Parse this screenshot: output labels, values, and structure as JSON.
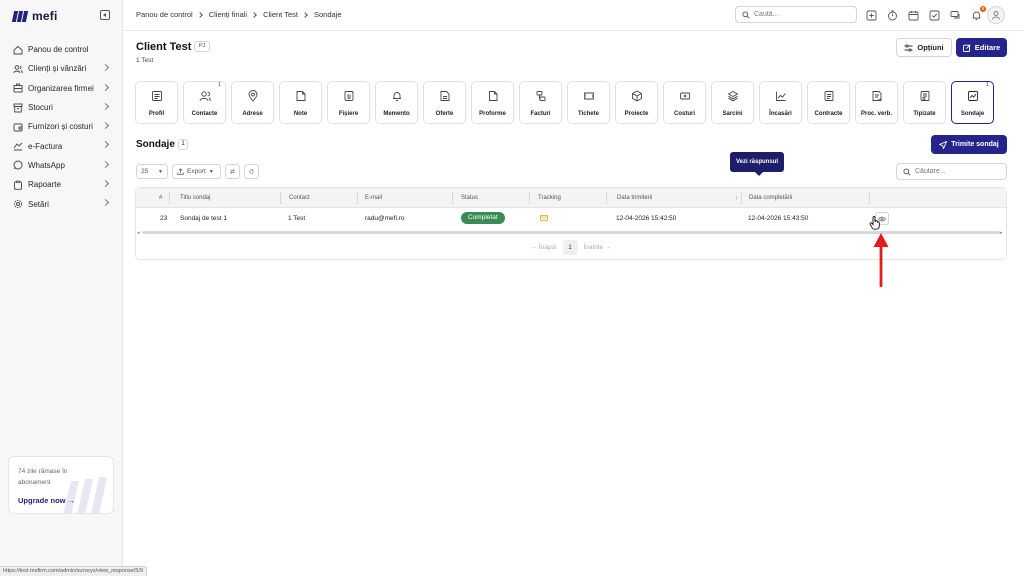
{
  "app": {
    "name": "mefi"
  },
  "sidebar": {
    "items": [
      {
        "label": "Panou de control",
        "icon": "home-icon",
        "chevron": false
      },
      {
        "label": "Clienți și vânzări",
        "icon": "users-icon",
        "chevron": true
      },
      {
        "label": "Organizarea firmei",
        "icon": "org-icon",
        "chevron": true
      },
      {
        "label": "Stocuri",
        "icon": "box-icon",
        "chevron": true
      },
      {
        "label": "Furnizori și costuri",
        "icon": "wallet-icon",
        "chevron": true
      },
      {
        "label": "e-Factura",
        "icon": "efactura-icon",
        "chevron": true
      },
      {
        "label": "WhatsApp",
        "icon": "whatsapp-icon",
        "chevron": true
      },
      {
        "label": "Rapoarte",
        "icon": "clipboard-icon",
        "chevron": true
      },
      {
        "label": "Setări",
        "icon": "gear-icon",
        "chevron": true
      }
    ],
    "upgrade": {
      "days_text": "74 zile rămase în abonament",
      "link_label": "Upgrade now"
    }
  },
  "header": {
    "breadcrumbs": [
      "Panou de control",
      "Clienți finali",
      "Client Test",
      "Sondaje"
    ],
    "search_placeholder": "Caută...",
    "notification_count": "9"
  },
  "client": {
    "name": "Client Test",
    "type_badge": "PJ",
    "contact_line": "1 Test",
    "options_label": "Opțiuni",
    "edit_label": "Editare"
  },
  "tabs": [
    {
      "label": "Profil",
      "icon": "profile-icon",
      "count": ""
    },
    {
      "label": "Contacte",
      "icon": "contacts-icon",
      "count": "1"
    },
    {
      "label": "Adrese",
      "icon": "pin-icon",
      "count": ""
    },
    {
      "label": "Note",
      "icon": "note-icon",
      "count": ""
    },
    {
      "label": "Fișiere",
      "icon": "file-icon",
      "count": ""
    },
    {
      "label": "Memento",
      "icon": "bell-icon",
      "count": ""
    },
    {
      "label": "Oferte",
      "icon": "offer-icon",
      "count": ""
    },
    {
      "label": "Proforme",
      "icon": "proforma-icon",
      "count": ""
    },
    {
      "label": "Facturi",
      "icon": "invoice-icon",
      "count": ""
    },
    {
      "label": "Tichete",
      "icon": "ticket-icon",
      "count": ""
    },
    {
      "label": "Proiecte",
      "icon": "cube-icon",
      "count": ""
    },
    {
      "label": "Costuri",
      "icon": "cost-icon",
      "count": ""
    },
    {
      "label": "Sarcini",
      "icon": "layers-icon",
      "count": ""
    },
    {
      "label": "Încasări",
      "icon": "chart-line-icon",
      "count": ""
    },
    {
      "label": "Contracte",
      "icon": "contract-icon",
      "count": ""
    },
    {
      "label": "Proc. verb.",
      "icon": "report-icon",
      "count": ""
    },
    {
      "label": "Tipizate",
      "icon": "form-icon",
      "count": ""
    },
    {
      "label": "Sondaje",
      "icon": "survey-icon",
      "count": "1"
    }
  ],
  "surveys": {
    "title": "Sondaje",
    "count": "1",
    "send_label": "Trimite sondaj",
    "page_size": "25",
    "export_label": "Export",
    "search_placeholder": "Căutare...",
    "columns": [
      "#",
      "Titlu sondaj",
      "Contact",
      "E-mail",
      "Status",
      "Tracking",
      "Data trimiterii",
      "Data completării"
    ],
    "rows": [
      {
        "id": "23",
        "title": "Sondaj de test 1",
        "contact": "1 Test",
        "email": "radu@mefi.ro",
        "status": "Completat",
        "sent": "12-04-2026 15:42:50",
        "completed": "12-04-2026 15:43:50"
      }
    ],
    "tooltip": "Vezi răspunsul",
    "pager": {
      "prev": "Înapoi",
      "page": "1",
      "next": "Înainte"
    }
  },
  "colors": {
    "accent": "#24248a",
    "status_completed": "#3a8a55",
    "tracking_mail": "#e8b339",
    "annotation_arrow": "#e11d1d"
  },
  "statusbar_url": "https://test.mefirm.com/admin/surveys/view_response/5/9"
}
